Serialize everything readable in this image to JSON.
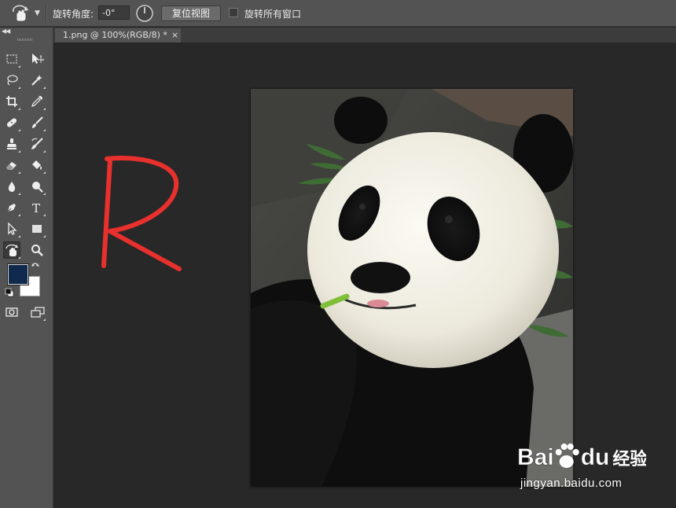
{
  "options_bar": {
    "tool": "rotate-view-tool",
    "rotate_angle_label": "旋转角度:",
    "rotate_angle_value": "-0°",
    "reset_view_label": "复位视图",
    "rotate_all_windows_label": "旋转所有窗口",
    "rotate_all_windows_checked": false
  },
  "document_tab": {
    "title": "1.png @ 100%(RGB/8) *",
    "close": "×"
  },
  "colors": {
    "foreground": "#0f2a4d",
    "background": "#ffffff",
    "annotation": "#e8302d"
  },
  "toolbar": {
    "tools": [
      "rectangular-marquee-icon",
      "move-icon",
      "lasso-icon",
      "magic-wand-icon",
      "crop-icon",
      "eyedropper-icon",
      "healing-brush-icon",
      "brush-icon",
      "clone-stamp-icon",
      "history-brush-icon",
      "eraser-icon",
      "paint-bucket-icon",
      "blur-icon",
      "dodge-icon",
      "pen-icon",
      "type-icon",
      "path-selection-icon",
      "rectangle-shape-icon",
      "rotate-view-icon",
      "zoom-icon",
      "quick-mask-icon",
      "screen-mode-icon"
    ],
    "type_tool_glyph": "T"
  },
  "canvas": {
    "image": "panda-photo",
    "annotation_letter": "R"
  },
  "watermark": {
    "brand": "Bai",
    "brand_suffix": "du",
    "product": "经验",
    "url": "jingyan.baidu.com"
  }
}
